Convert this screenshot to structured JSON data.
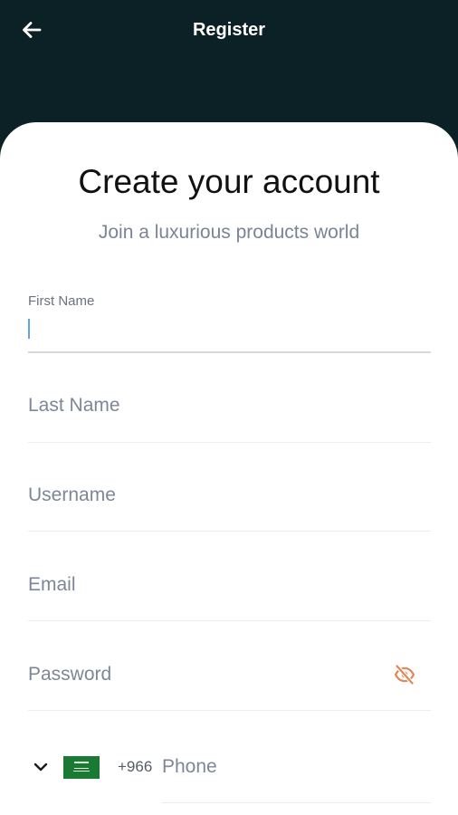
{
  "header": {
    "title": "Register",
    "back_icon": "arrow-left-icon"
  },
  "main": {
    "heading": "Create your account",
    "subheading": "Join a luxurious products world"
  },
  "form": {
    "first_name": {
      "label": "First Name",
      "value": ""
    },
    "last_name": {
      "placeholder": "Last Name",
      "value": ""
    },
    "username": {
      "placeholder": "Username",
      "value": ""
    },
    "email": {
      "placeholder": "Email",
      "value": ""
    },
    "password": {
      "placeholder": "Password",
      "value": "",
      "toggle_icon": "eye-off-icon"
    },
    "phone": {
      "country_flag": "saudi-arabia-flag-icon",
      "dial_code": "+966",
      "placeholder": "Phone",
      "value": "",
      "dropdown_icon": "chevron-down-icon"
    }
  },
  "colors": {
    "header_bg": "#0b2125",
    "sheet_bg": "#ffffff",
    "caret": "#5aa6e8",
    "eye_icon": "#e0875a",
    "placeholder": "#7d8796"
  }
}
